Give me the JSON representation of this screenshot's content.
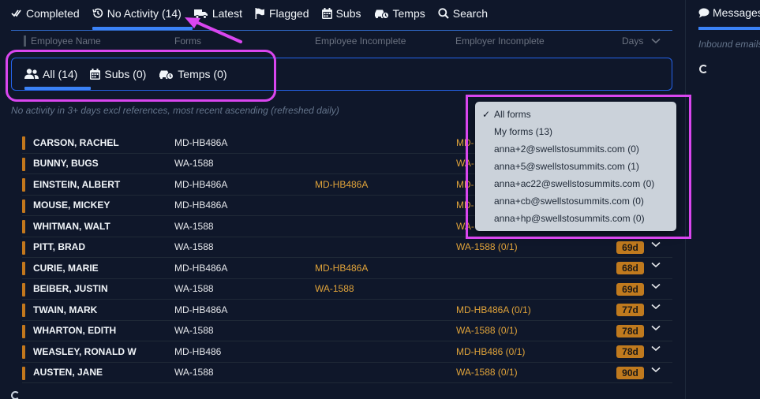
{
  "topnav": [
    {
      "icon": "double-check-icon",
      "label": "Completed"
    },
    {
      "icon": "history-icon",
      "label": "No Activity (14)",
      "active": true
    },
    {
      "icon": "truck-icon",
      "label": "Latest"
    },
    {
      "icon": "flag-icon",
      "label": "Flagged"
    },
    {
      "icon": "calendar-icon",
      "label": "Subs"
    },
    {
      "icon": "car-clock-icon",
      "label": "Temps"
    },
    {
      "icon": "search-icon",
      "label": "Search"
    }
  ],
  "columns": {
    "employee_name": "Employee Name",
    "forms": "Forms",
    "employee_incomplete": "Employee Incomplete",
    "employer_incomplete": "Employer Incomplete",
    "days": "Days"
  },
  "subtabs": [
    {
      "icon": "users-icon",
      "label": "All (14)",
      "active": true
    },
    {
      "icon": "calendar-icon",
      "label": "Subs (0)"
    },
    {
      "icon": "car-clock-icon",
      "label": "Temps (0)"
    }
  ],
  "description": "No activity in 3+ days excl references, most recent ascending (refreshed daily)",
  "rows": [
    {
      "name": "CARSON, RACHEL",
      "forms": "MD-HB486A",
      "emp_inc": "",
      "empr_inc": "MD-",
      "days": ""
    },
    {
      "name": "BUNNY, BUGS",
      "forms": "WA-1588",
      "emp_inc": "",
      "empr_inc": "WA-",
      "days": ""
    },
    {
      "name": "EINSTEIN, ALBERT",
      "forms": "MD-HB486A",
      "emp_inc": "MD-HB486A",
      "empr_inc": "MD-",
      "days": ""
    },
    {
      "name": "MOUSE, MICKEY",
      "forms": "MD-HB486A",
      "emp_inc": "",
      "empr_inc": "MD-",
      "days": ""
    },
    {
      "name": "WHITMAN, WALT",
      "forms": "WA-1588",
      "emp_inc": "",
      "empr_inc": "WA-",
      "days": ""
    },
    {
      "name": "PITT, BRAD",
      "forms": "WA-1588",
      "emp_inc": "",
      "empr_inc": "WA-1588 (0/1)",
      "days": "69d"
    },
    {
      "name": "CURIE, MARIE",
      "forms": "MD-HB486A",
      "emp_inc": "MD-HB486A",
      "empr_inc": "",
      "days": "68d"
    },
    {
      "name": "BEIBER, JUSTIN",
      "forms": "WA-1588",
      "emp_inc": "WA-1588",
      "empr_inc": "",
      "days": "69d"
    },
    {
      "name": "TWAIN, MARK",
      "forms": "MD-HB486A",
      "emp_inc": "",
      "empr_inc": "MD-HB486A (0/1)",
      "days": "77d"
    },
    {
      "name": "WHARTON, EDITH",
      "forms": "WA-1588",
      "emp_inc": "",
      "empr_inc": "WA-1588 (0/1)",
      "days": "78d"
    },
    {
      "name": "WEASLEY, RONALD W",
      "forms": "MD-HB486",
      "emp_inc": "",
      "empr_inc": "MD-HB486 (0/1)",
      "days": "78d"
    },
    {
      "name": "AUSTEN, JANE",
      "forms": "WA-1588",
      "emp_inc": "",
      "empr_inc": "WA-1588 (0/1)",
      "days": "90d"
    }
  ],
  "dropdown": {
    "check": "✓",
    "items": [
      "All forms",
      "My forms (13)",
      "anna+2@swellstosummits.com (0)",
      "anna+5@swellstosummits.com (1)",
      "anna+ac22@swellstosummits.com (0)",
      "anna+cb@swellstosummits.com (0)",
      "anna+hp@swellstosummits.com (0)"
    ]
  },
  "right_panel": {
    "title": "Messages",
    "subtitle": "Inbound emails"
  },
  "colors": {
    "accent": "#3b82f6",
    "highlight": "#d946ef",
    "status": "#c07a1e",
    "warn_text": "#e0a33a",
    "background": "#0f172a"
  }
}
